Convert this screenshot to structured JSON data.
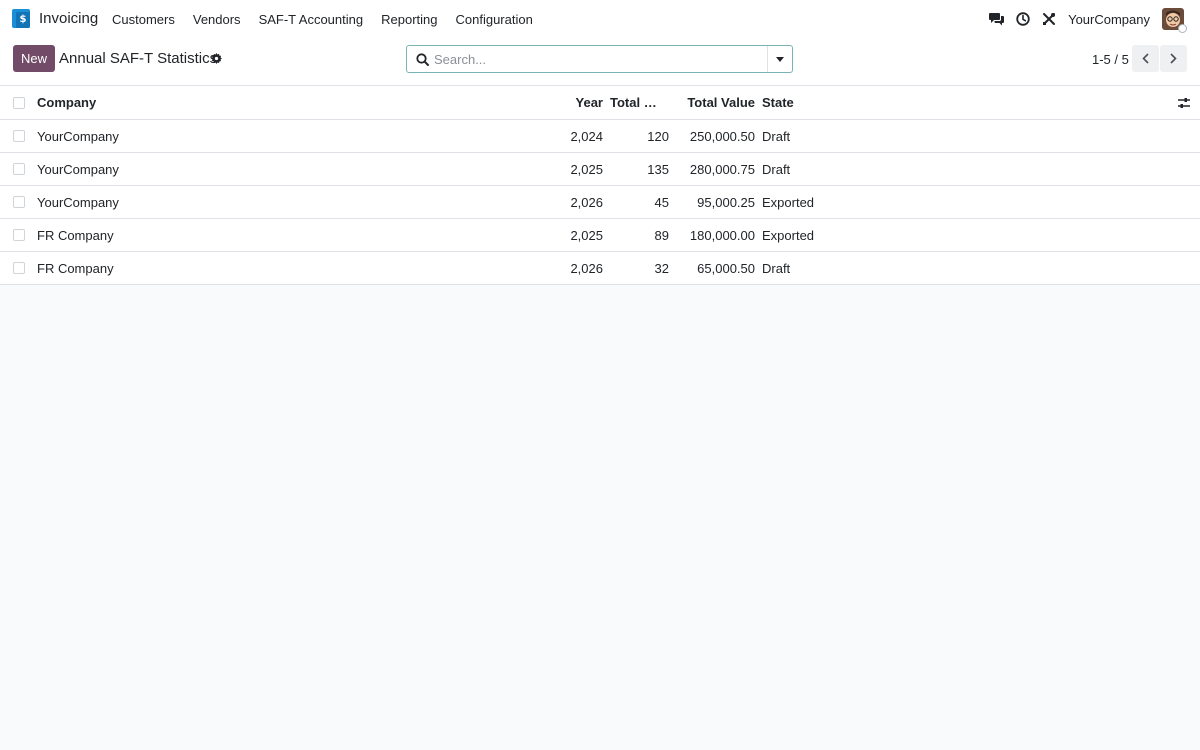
{
  "navbar": {
    "app_name": "Invoicing",
    "menu": [
      "Customers",
      "Vendors",
      "SAF-T Accounting",
      "Reporting",
      "Configuration"
    ],
    "company": "YourCompany"
  },
  "control_panel": {
    "new_label": "New",
    "title": "Annual SAF-T Statistics",
    "search_placeholder": "Search...",
    "pager": "1-5 / 5"
  },
  "table": {
    "headers": {
      "company": "Company",
      "year": "Year",
      "total_docs": "Total Do...",
      "total_value": "Total Value",
      "state": "State"
    },
    "rows": [
      {
        "company": "YourCompany",
        "year": "2,024",
        "total_docs": "120",
        "total_value": "250,000.50",
        "state": "Draft"
      },
      {
        "company": "YourCompany",
        "year": "2,025",
        "total_docs": "135",
        "total_value": "280,000.75",
        "state": "Draft"
      },
      {
        "company": "YourCompany",
        "year": "2,026",
        "total_docs": "45",
        "total_value": "95,000.25",
        "state": "Exported"
      },
      {
        "company": "FR Company",
        "year": "2,025",
        "total_docs": "89",
        "total_value": "180,000.00",
        "state": "Exported"
      },
      {
        "company": "FR Company",
        "year": "2,026",
        "total_docs": "32",
        "total_value": "65,000.50",
        "state": "Draft"
      }
    ]
  },
  "colors": {
    "brand": "#714b67",
    "app_icon": "#1a8fd8",
    "search_border": "#7ab3b5"
  },
  "icons": {
    "app": "invoicing-app-icon",
    "messages": "chat-bubbles-icon",
    "activities": "clock-icon",
    "debug": "tools-icon",
    "settings": "gear-icon",
    "search": "search-icon",
    "toggle": "caret-down-icon",
    "prev": "chevron-left-icon",
    "next": "chevron-right-icon",
    "columns": "sliders-icon"
  }
}
